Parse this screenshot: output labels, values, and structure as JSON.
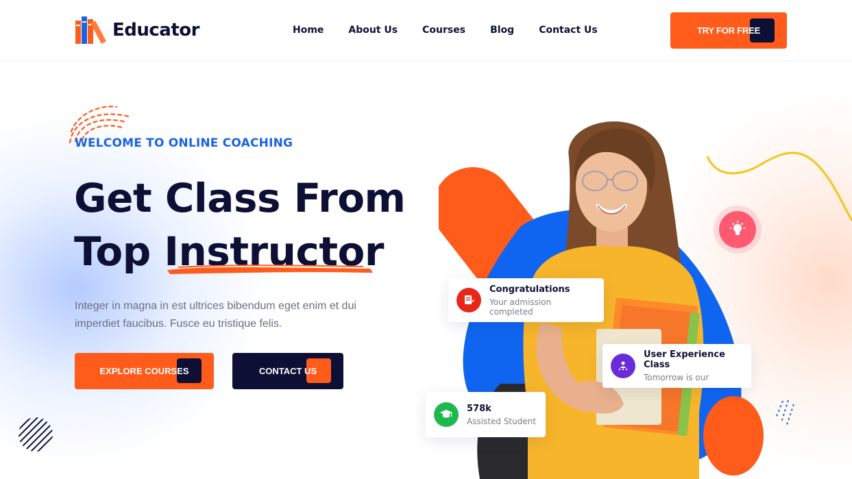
{
  "brand": {
    "name": "Educator"
  },
  "nav": {
    "items": [
      {
        "label": "Home"
      },
      {
        "label": "About Us"
      },
      {
        "label": "Courses"
      },
      {
        "label": "Blog"
      },
      {
        "label": "Contact Us"
      }
    ]
  },
  "header": {
    "cta_label": "TRY FOR FREE"
  },
  "hero": {
    "welcome": "WELCOME TO ONLINE COACHING",
    "headline_line1": "Get Class From",
    "headline_line2_a": "Top ",
    "headline_line2_b": "Instructor",
    "description": "Integer in magna in est ultrices bibendum eget enim et dui imperdiet faucibus. Fusce eu tristique felis.",
    "explore_label": "EXPLORE COURSES",
    "contact_label": "CONTACT US"
  },
  "cards": {
    "congrats": {
      "title": "Congratulations",
      "subtitle": "Your admission completed",
      "icon": "document-edit-icon"
    },
    "ux_class": {
      "title": "User Experience Class",
      "subtitle": "Tomorrow is our",
      "icon": "presenter-icon"
    },
    "students": {
      "title": "578k",
      "subtitle": "Assisted Student",
      "icon": "graduation-cap-icon"
    }
  },
  "colors": {
    "navy": "#0d1034",
    "orange": "#ff5b1a",
    "blue": "#1b63e0",
    "yellow_shirt": "#f7b52c",
    "green": "#1fb84f",
    "red": "#e8271b",
    "purple": "#6a2bd9",
    "pink": "#ff5a72"
  }
}
